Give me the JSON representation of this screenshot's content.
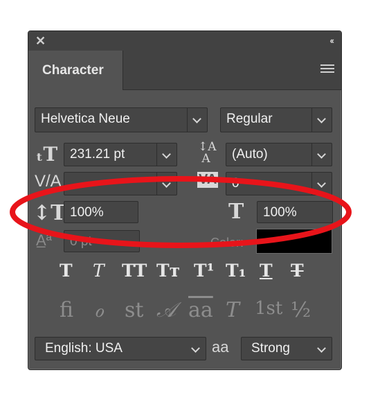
{
  "panel": {
    "close_icon": "close-icon",
    "collapse_icon": "double-chevron-left-icon",
    "tab_label": "Character",
    "menu_icon": "hamburger-menu-icon"
  },
  "font": {
    "family": "Helvetica Neue",
    "style": "Regular"
  },
  "sizes": {
    "font_size": "231.21 pt",
    "leading": "(Auto)",
    "kerning": "",
    "tracking": "0",
    "vertical_scale": "100%",
    "horizontal_scale": "100%",
    "baseline_shift": "0 pt",
    "color_label": "Color:",
    "color_value": "#000000"
  },
  "style_buttons": [
    "T",
    "T",
    "TT",
    "Tт",
    "T¹",
    "T₁",
    "T",
    "T"
  ],
  "opentype_buttons": [
    "ﬁ",
    "ℴ",
    "st",
    "𝒜",
    "aa",
    "T",
    "1st",
    "½"
  ],
  "footer": {
    "language": "English: USA",
    "antialias_icon": "aa",
    "antialias": "Strong"
  },
  "annotation": {
    "color": "#e8141a"
  }
}
